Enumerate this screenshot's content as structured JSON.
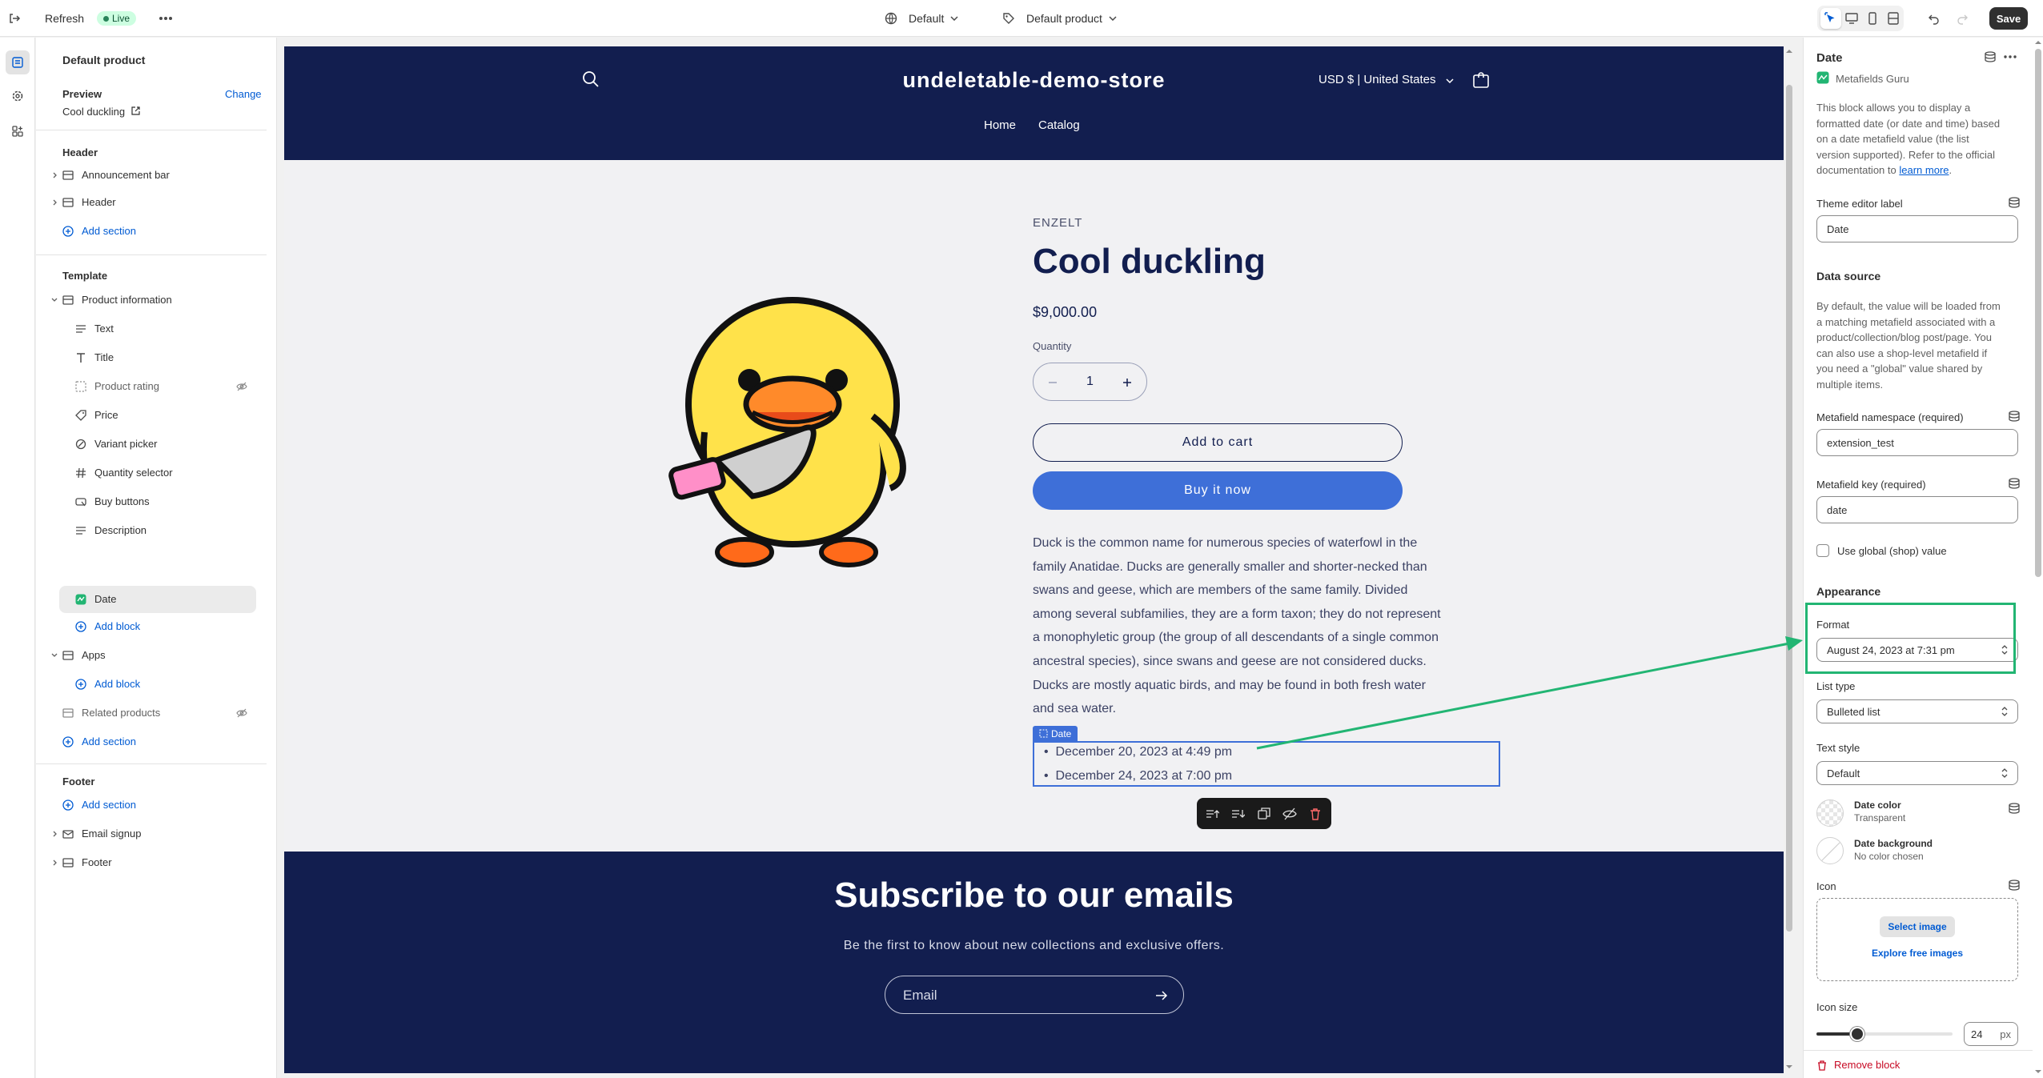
{
  "topbar": {
    "refresh": "Refresh",
    "live": "Live",
    "theme": "Default",
    "template": "Default product",
    "save": "Save"
  },
  "left": {
    "title": "Default product",
    "preview_label": "Preview",
    "change": "Change",
    "preview_value": "Cool duckling",
    "header_group": "Header",
    "announcement": "Announcement bar",
    "header": "Header",
    "add_section": "Add section",
    "template_group": "Template",
    "product_info": "Product information",
    "blocks": [
      "Text",
      "Title",
      "Product rating",
      "Price",
      "Variant picker",
      "Quantity selector",
      "Buy buttons",
      "Description",
      "Date"
    ],
    "add_block": "Add block",
    "apps": "Apps",
    "related": "Related products",
    "footer_group": "Footer",
    "email_signup": "Email signup",
    "footer": "Footer"
  },
  "store": {
    "name": "undeletable-demo-store",
    "currency": "USD $ | United States",
    "nav": [
      "Home",
      "Catalog"
    ],
    "vendor": "ENZELT",
    "title": "Cool duckling",
    "price": "$9,000.00",
    "qty_label": "Quantity",
    "qty": "1",
    "add_to_cart": "Add to cart",
    "buy_now": "Buy it now",
    "description": [
      "Duck is the common name for numerous species of waterfowl in the",
      "family Anatidae. Ducks are generally smaller and shorter-necked than",
      "swans and geese, which are members of the same family. Divided",
      "among several subfamilies, they are a form taxon; they do not represent",
      "a monophyletic group (the group of all descendants of a single common",
      "ancestral species), since swans and geese are not considered ducks.",
      "Ducks are mostly aquatic birds, and may be found in both fresh water",
      "and sea water."
    ],
    "date_tag": "Date",
    "dates": [
      "December 20, 2023 at 4:49 pm",
      "December 24, 2023 at 7:00 pm"
    ],
    "subscribe": "Subscribe to our emails",
    "subscribe_sub": "Be the first to know about new collections and exclusive offers.",
    "email_placeholder": "Email"
  },
  "right": {
    "title": "Date",
    "app": "Metafields Guru",
    "intro": [
      "This block allows you to display a",
      "formatted date (or date and time) based",
      "on a date metafield value (the list",
      "version supported). Refer to the official"
    ],
    "intro_last": "documentation to",
    "learn_more": "learn more",
    "period": ".",
    "label_label": "Theme editor label",
    "label_value": "Date",
    "data_source": "Data source",
    "ds_text": [
      "By default, the value will be loaded from",
      "a matching metafield associated with a",
      "product/collection/blog post/page. You",
      "can also use a shop-level metafield if",
      "you need a \"global\" value shared by",
      "multiple items."
    ],
    "ns_label": "Metafield namespace (required)",
    "ns_value": "extension_test",
    "key_label": "Metafield key (required)",
    "key_value": "date",
    "global": "Use global (shop) value",
    "appearance": "Appearance",
    "format_label": "Format",
    "format_value": "August 24, 2023 at 7:31 pm",
    "list_label": "List type",
    "list_value": "Bulleted list",
    "style_label": "Text style",
    "style_value": "Default",
    "date_color": "Date color",
    "date_color_val": "Transparent",
    "date_bg": "Date background",
    "date_bg_val": "No color chosen",
    "icon_label": "Icon",
    "select_image": "Select image",
    "explore": "Explore free images",
    "icon_size": "Icon size",
    "icon_size_val": "24",
    "px": "px",
    "icon_size_level": 0.3,
    "remove": "Remove block"
  },
  "colors": {
    "accent": "#005bd3",
    "highlight": "#22b573",
    "store_dark": "#121e4f",
    "buy_blue": "#3e6fd8"
  }
}
